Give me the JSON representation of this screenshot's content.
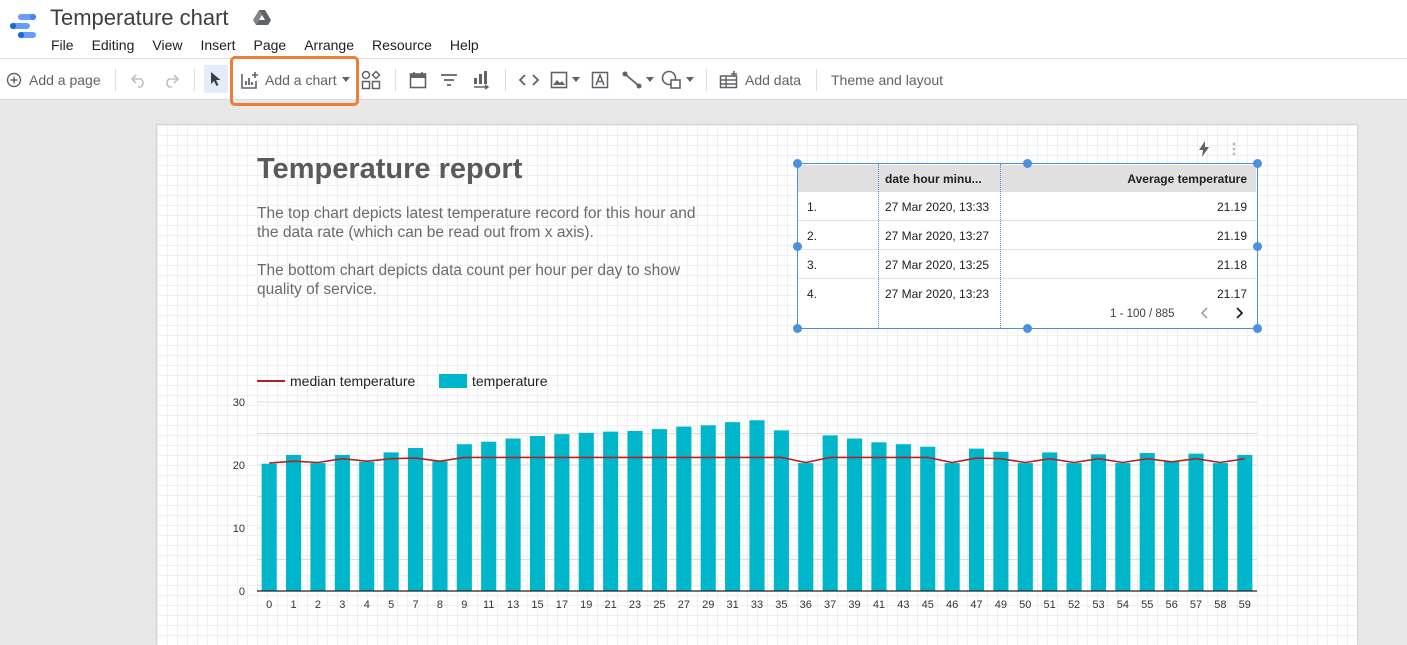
{
  "app": {
    "title": "Temperature chart",
    "menu": [
      "File",
      "Editing",
      "View",
      "Insert",
      "Page",
      "Arrange",
      "Resource",
      "Help"
    ]
  },
  "toolbar": {
    "add_page": "Add a page",
    "add_chart": "Add a chart",
    "add_data": "Add data",
    "theme_layout": "Theme and layout",
    "highlight_color": "#f07c3a"
  },
  "report": {
    "title": "Temperature report",
    "para1": "The top chart depicts latest temperature record for this hour and the data rate (which can be read out from x axis).",
    "para2": "The bottom chart depicts data count per hour per day to show quality of service."
  },
  "table": {
    "headers": [
      "date hour minu...",
      "Average temperature"
    ],
    "rows": [
      {
        "num": "1.",
        "date": "27 Mar 2020, 13:33",
        "value": "21.19"
      },
      {
        "num": "2.",
        "date": "27 Mar 2020, 13:27",
        "value": "21.19"
      },
      {
        "num": "3.",
        "date": "27 Mar 2020, 13:25",
        "value": "21.18"
      },
      {
        "num": "4.",
        "date": "27 Mar 2020, 13:23",
        "value": "21.17"
      }
    ],
    "pagination": "1 - 100 / 885"
  },
  "chart_data": {
    "type": "bar",
    "categories": [
      "0",
      "1",
      "2",
      "3",
      "4",
      "5",
      "7",
      "8",
      "9",
      "11",
      "13",
      "15",
      "17",
      "19",
      "21",
      "23",
      "25",
      "27",
      "29",
      "31",
      "33",
      "35",
      "36",
      "37",
      "39",
      "41",
      "43",
      "45",
      "46",
      "47",
      "49",
      "50",
      "51",
      "52",
      "53",
      "54",
      "55",
      "56",
      "57",
      "58",
      "59"
    ],
    "series": [
      {
        "name": "temperature",
        "type": "bar",
        "color": "#00b6cb",
        "values": [
          20.2,
          21.6,
          20.3,
          21.6,
          20.5,
          22.0,
          22.7,
          20.6,
          23.3,
          23.7,
          24.2,
          24.6,
          24.9,
          25.1,
          25.3,
          25.4,
          25.7,
          26.1,
          26.3,
          26.8,
          27.1,
          25.5,
          20.3,
          24.7,
          24.2,
          23.6,
          23.3,
          22.9,
          20.3,
          22.6,
          22.1,
          20.3,
          22.0,
          20.3,
          21.7,
          20.3,
          21.9,
          20.6,
          21.8,
          20.3,
          21.6
        ]
      },
      {
        "name": "median temperature",
        "type": "line",
        "color": "#b22222",
        "values": [
          20.3,
          20.6,
          20.4,
          21.0,
          20.6,
          21.0,
          21.1,
          20.6,
          21.2,
          21.2,
          21.2,
          21.2,
          21.2,
          21.2,
          21.2,
          21.2,
          21.2,
          21.2,
          21.2,
          21.2,
          21.2,
          21.2,
          20.4,
          21.2,
          21.2,
          21.2,
          21.2,
          21.2,
          20.4,
          21.1,
          21.0,
          20.4,
          21.0,
          20.4,
          21.0,
          20.4,
          21.0,
          20.5,
          21.0,
          20.4,
          21.0
        ]
      }
    ],
    "yticks": [
      0,
      10,
      20,
      30
    ],
    "ylim": [
      0,
      30
    ],
    "grid": true,
    "legend": "top-left"
  }
}
